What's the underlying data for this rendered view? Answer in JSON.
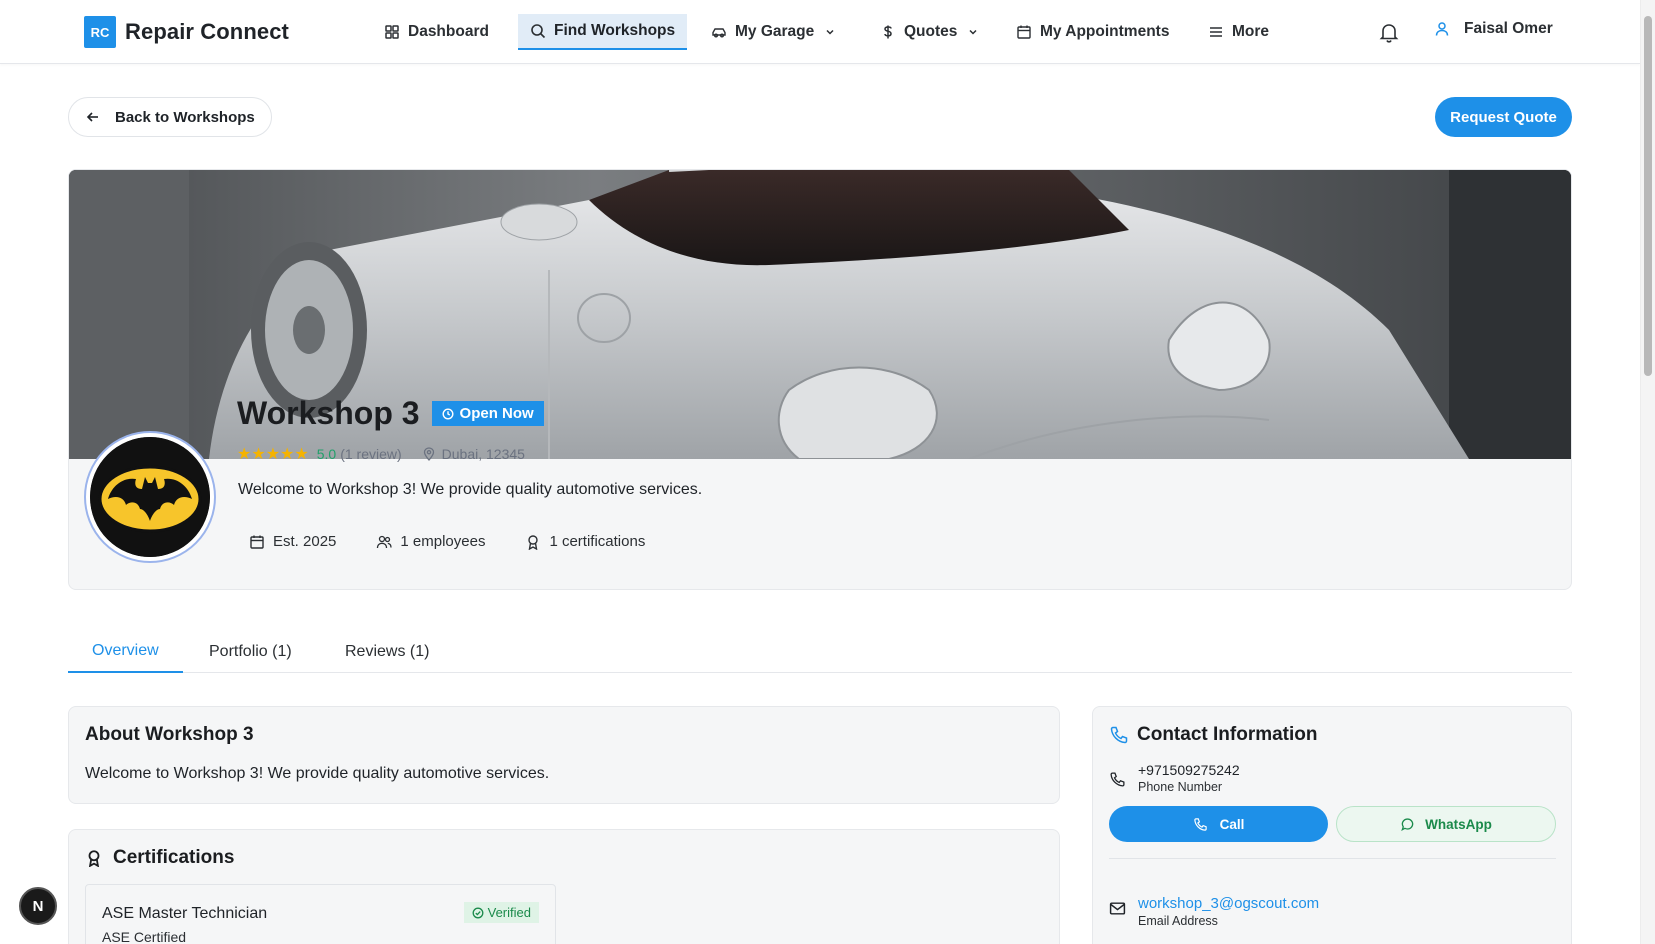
{
  "app": {
    "logo_initials": "RC",
    "logo_name": "Repair Connect",
    "accent": "#1e90e8"
  },
  "nav": {
    "items": [
      {
        "label": "Dashboard",
        "icon": "grid-icon"
      },
      {
        "label": "Find Workshops",
        "icon": "search-icon",
        "active": true
      },
      {
        "label": "My Garage",
        "icon": "car-icon"
      },
      {
        "label": "Quotes",
        "icon": "dollar-icon"
      },
      {
        "label": "My Appointments",
        "icon": "calendar-icon"
      },
      {
        "label": "More",
        "icon": "menu-icon"
      }
    ],
    "user_name": "Faisal Omer"
  },
  "actions": {
    "back_label": "Back to Workshops",
    "request_label": "Request Quote"
  },
  "workshop": {
    "name": "Workshop 3",
    "status": "Open Now",
    "stars": "★★★★★",
    "rating": "5.0",
    "reviews_text": "(1 review)",
    "location": "Dubai, 12345",
    "description": "Welcome to Workshop 3! We provide quality automotive services.",
    "established": "Est. 2025",
    "employees": "1 employees",
    "certifications_count": "1 certifications"
  },
  "tabs": [
    {
      "label": "Overview",
      "active": true
    },
    {
      "label": "Portfolio (1)"
    },
    {
      "label": "Reviews (1)"
    }
  ],
  "about": {
    "title": "About Workshop 3",
    "text": "Welcome to Workshop 3! We provide quality automotive services."
  },
  "certifications": {
    "title": "Certifications",
    "items": [
      {
        "name": "ASE Master Technician",
        "issuer": "ASE Certified",
        "badge": "Verified"
      }
    ]
  },
  "contact": {
    "title": "Contact Information",
    "phone": "+971509275242",
    "phone_label": "Phone Number",
    "call_label": "Call",
    "whatsapp_label": "WhatsApp",
    "email": "workshop_3@ogscout.com",
    "email_label": "Email Address"
  },
  "floating": {
    "label": "N"
  }
}
